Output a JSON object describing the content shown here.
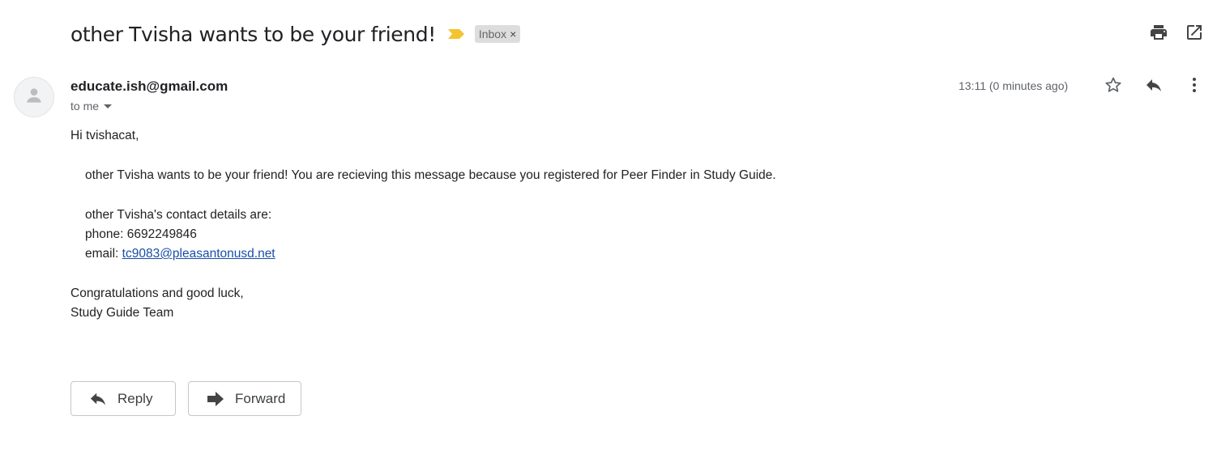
{
  "message": {
    "subject": "other Tvisha wants to be your friend!",
    "label": "Inbox",
    "label_close": "×",
    "sender_email": "educate.ish@gmail.com",
    "recipient": "to me",
    "timestamp": "13:11 (0 minutes ago)"
  },
  "body": {
    "greeting": "Hi tvishacat,",
    "line_intro": "other Tvisha wants to be your friend! You are recieving this message because you registered for Peer Finder in Study Guide.",
    "contact_intro": "other Tvisha's contact details are:",
    "phone_label": "phone: ",
    "phone": "6692249846",
    "email_label": "email: ",
    "email": "tc9083@pleasantonusd.net",
    "signoff": "Congratulations and good luck,",
    "signature": "Study Guide Team"
  },
  "actions": {
    "reply_label": "Reply",
    "forward_label": "Forward"
  },
  "icons": {
    "importance": "importance-marker-icon",
    "print": "print-icon",
    "new_window": "open-in-new-window-icon",
    "avatar": "default-avatar-icon",
    "star": "star-icon",
    "reply": "reply-icon",
    "more": "more-vertical-icon",
    "forward": "forward-icon"
  },
  "colors": {
    "importance": "#f4c430",
    "label_chip_bg": "#dddddd",
    "link": "#1a4ea8",
    "muted": "#5f6368"
  }
}
